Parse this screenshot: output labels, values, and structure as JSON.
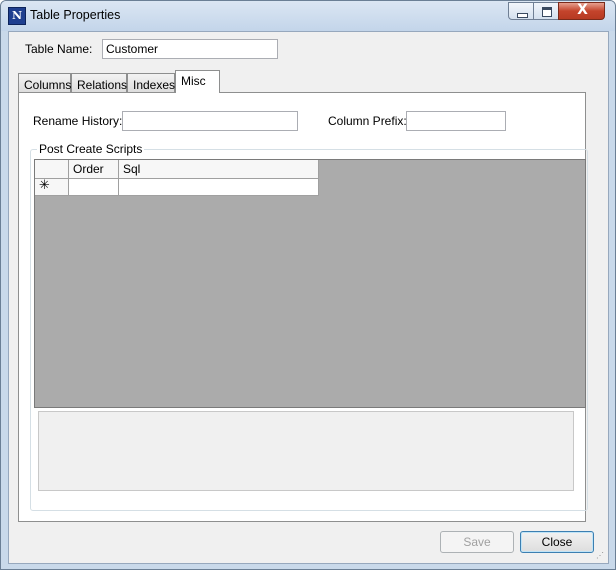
{
  "window": {
    "title": "Table Properties",
    "icon_letter": "N",
    "close_glyph": "X"
  },
  "form": {
    "table_name_label": "Table Name:",
    "table_name_value": "Customer"
  },
  "tabs": [
    {
      "label": "Columns",
      "active": false
    },
    {
      "label": "Relations",
      "active": false
    },
    {
      "label": "Indexes",
      "active": false
    },
    {
      "label": "Misc",
      "active": true
    }
  ],
  "misc": {
    "rename_history_label": "Rename History:",
    "rename_history_value": "",
    "column_prefix_label": "Column Prefix:",
    "column_prefix_value": "",
    "post_create_legend": "Post Create Scripts",
    "grid": {
      "columns": [
        "Order",
        "Sql"
      ],
      "new_row_marker": "✳",
      "rows": []
    },
    "script_text": ""
  },
  "buttons": {
    "save_label": "Save",
    "close_label": "Close"
  },
  "colors": {
    "grid_background": "#ababab",
    "title_bar": "#c9d9ea",
    "close_button": "#c4442c"
  }
}
